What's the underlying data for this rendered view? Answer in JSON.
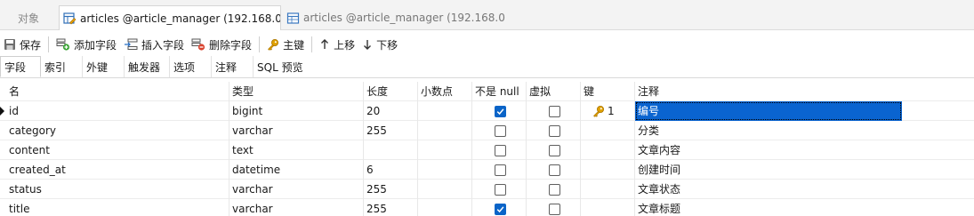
{
  "tabs": {
    "objects_label": "对象",
    "active_label": "articles @article_manager (192.168.0...",
    "inactive_label": "articles @article_manager (192.168.0..."
  },
  "toolbar": {
    "save": "保存",
    "add_field": "添加字段",
    "insert_field": "插入字段",
    "delete_field": "删除字段",
    "primary_key": "主键",
    "move_up": "上移",
    "move_down": "下移"
  },
  "subtabs": [
    "字段",
    "索引",
    "外键",
    "触发器",
    "选项",
    "注释",
    "SQL 预览"
  ],
  "columns": {
    "name": "名",
    "type": "类型",
    "length": "长度",
    "decimals": "小数点",
    "not_null": "不是 null",
    "virtual": "虚拟",
    "key": "键",
    "comment": "注释"
  },
  "rows": [
    {
      "name": "id",
      "type": "bigint",
      "length": "20",
      "decimals": "",
      "not_null": true,
      "virtual": false,
      "key": "1",
      "comment": "编号"
    },
    {
      "name": "category",
      "type": "varchar",
      "length": "255",
      "decimals": "",
      "not_null": false,
      "virtual": false,
      "key": "",
      "comment": "分类"
    },
    {
      "name": "content",
      "type": "text",
      "length": "",
      "decimals": "",
      "not_null": false,
      "virtual": false,
      "key": "",
      "comment": "文章内容"
    },
    {
      "name": "created_at",
      "type": "datetime",
      "length": "6",
      "decimals": "",
      "not_null": false,
      "virtual": false,
      "key": "",
      "comment": "创建时间"
    },
    {
      "name": "status",
      "type": "varchar",
      "length": "255",
      "decimals": "",
      "not_null": false,
      "virtual": false,
      "key": "",
      "comment": "文章状态"
    },
    {
      "name": "title",
      "type": "varchar",
      "length": "255",
      "decimals": "",
      "not_null": true,
      "virtual": false,
      "key": "",
      "comment": "文章标题"
    }
  ],
  "colors": {
    "selection": "#0a64d0",
    "checkbox_on": "#0a64c8",
    "key_icon": "#e0a100"
  }
}
